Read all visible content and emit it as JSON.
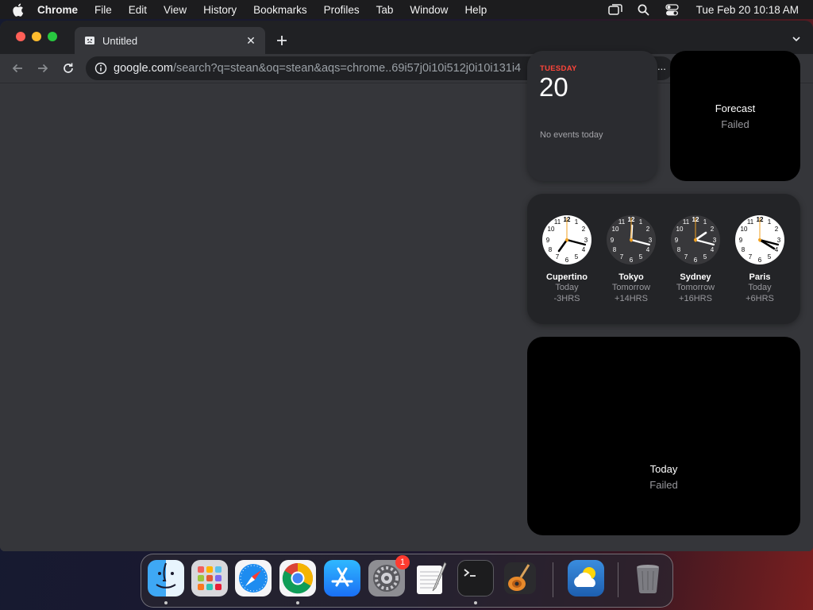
{
  "menubar": {
    "app_name": "Chrome",
    "items": [
      "File",
      "Edit",
      "View",
      "History",
      "Bookmarks",
      "Profiles",
      "Tab",
      "Window",
      "Help"
    ],
    "datetime": "Tue Feb 20  10:18 AM"
  },
  "browser": {
    "tab_title": "Untitled",
    "tab_close": "✕",
    "url_host": "google.com",
    "url_path": "/search?q=stean&oq=stean&aqs=chrome..69i57j0i10i512j0i10i131i4",
    "overflow": "..."
  },
  "widgets": {
    "calendar": {
      "weekday": "TUESDAY",
      "day": "20",
      "events": "No events today"
    },
    "forecast": {
      "title": "Forecast",
      "status": "Failed"
    },
    "world_clock": [
      {
        "city": "Cupertino",
        "relative": "Today",
        "offset": "-3HRS",
        "face": "light"
      },
      {
        "city": "Tokyo",
        "relative": "Tomorrow",
        "offset": "+14HRS",
        "face": "dark"
      },
      {
        "city": "Sydney",
        "relative": "Tomorrow",
        "offset": "+16HRS",
        "face": "dark"
      },
      {
        "city": "Paris",
        "relative": "Today",
        "offset": "+6HRS",
        "face": "light"
      }
    ],
    "today": {
      "title": "Today",
      "status": "Failed"
    }
  },
  "dock": {
    "apps": [
      "finder-icon",
      "launchpad-icon",
      "safari-icon",
      "chrome-icon",
      "app-store-icon",
      "system-settings-icon",
      "textedit-icon",
      "terminal-icon",
      "garageband-icon",
      "weather-icon",
      "trash-icon"
    ],
    "settings_badge": "1"
  },
  "colors": {
    "accent_red": "#ff453a",
    "window_bg": "#35363a",
    "tabstrip_bg": "#202124"
  }
}
